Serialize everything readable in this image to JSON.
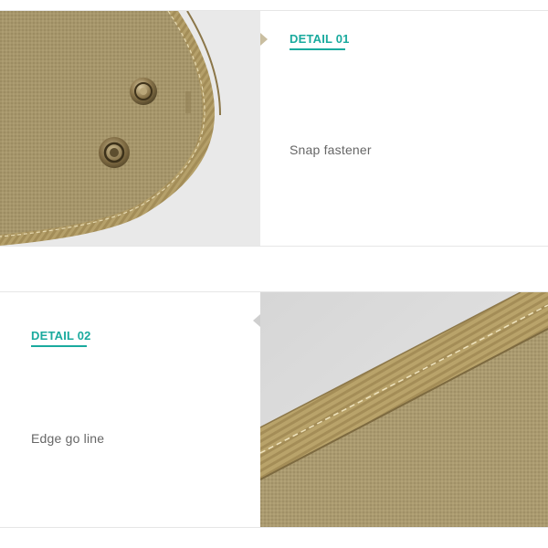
{
  "colors": {
    "accent": "#1aaa9e",
    "caption": "#666666",
    "fabric": "#a8976c",
    "binding": "#b09a62",
    "snap": "#8a7448"
  },
  "details": [
    {
      "title": "DETAIL 01",
      "caption": "Snap fastener"
    },
    {
      "title": "DETAIL 02",
      "caption": "Edge go line"
    }
  ]
}
